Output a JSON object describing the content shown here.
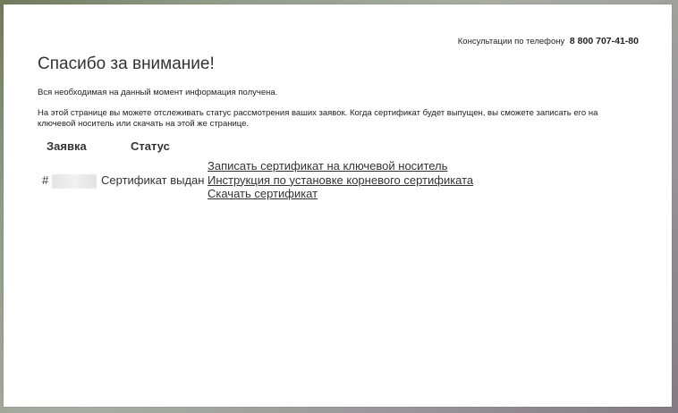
{
  "header": {
    "consult_label": "Консультации по телефону",
    "phone": "8 800 707-41-80"
  },
  "page": {
    "title": "Спасибо за внимание!",
    "info_line1": "Вся необходимая на данный момент информация получена.",
    "info_line2": "На этой странице вы можете отслеживать статус рассмотрения ваших заявок. Когда сертификат будет выпущен, вы сможете записать его на ключевой носитель или скачать на этой же странице."
  },
  "table": {
    "headers": {
      "request": "Заявка",
      "status": "Статус"
    },
    "row": {
      "number_prefix": "#",
      "status": "Сертификат выдан",
      "links": [
        "Записать сертификат на ключевой носитель",
        "Инструкция по установке корневого сертификата",
        "Скачать сертификат"
      ]
    }
  }
}
